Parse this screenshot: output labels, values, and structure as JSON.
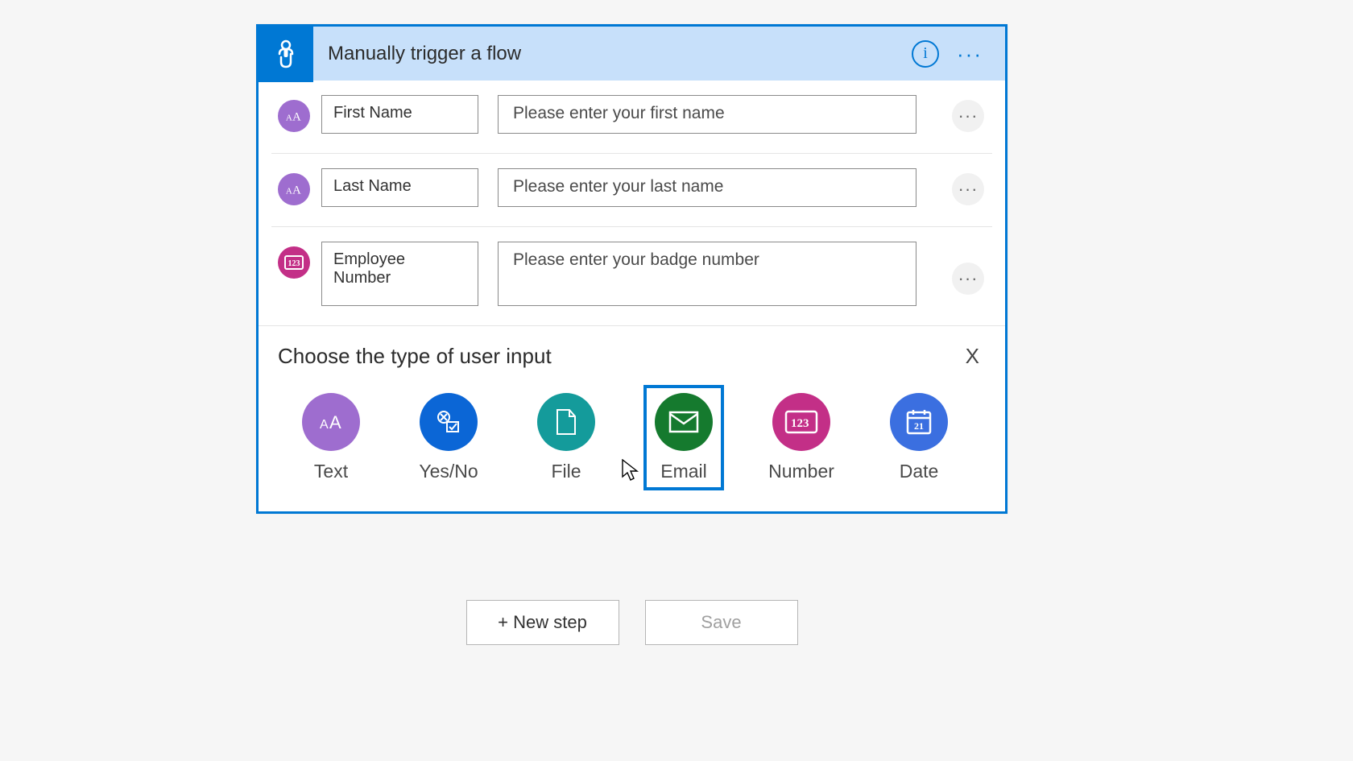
{
  "header": {
    "title": "Manually trigger a flow",
    "info_label": "i",
    "more_label": "···"
  },
  "inputs": [
    {
      "icon": "text",
      "name_label": "First Name",
      "placeholder": "Please enter your first name"
    },
    {
      "icon": "text",
      "name_label": "Last Name",
      "placeholder": "Please enter your last name"
    },
    {
      "icon": "number",
      "name_label": "Employee Number",
      "placeholder": "Please enter your badge number"
    }
  ],
  "choose": {
    "title": "Choose the type of user input",
    "close_label": "X",
    "types": [
      {
        "key": "text",
        "label": "Text"
      },
      {
        "key": "yesno",
        "label": "Yes/No"
      },
      {
        "key": "file",
        "label": "File"
      },
      {
        "key": "email",
        "label": "Email",
        "selected": true
      },
      {
        "key": "number",
        "label": "Number"
      },
      {
        "key": "date",
        "label": "Date"
      }
    ]
  },
  "footer": {
    "new_step_label": "+ New step",
    "save_label": "Save"
  },
  "row_more_label": "···"
}
